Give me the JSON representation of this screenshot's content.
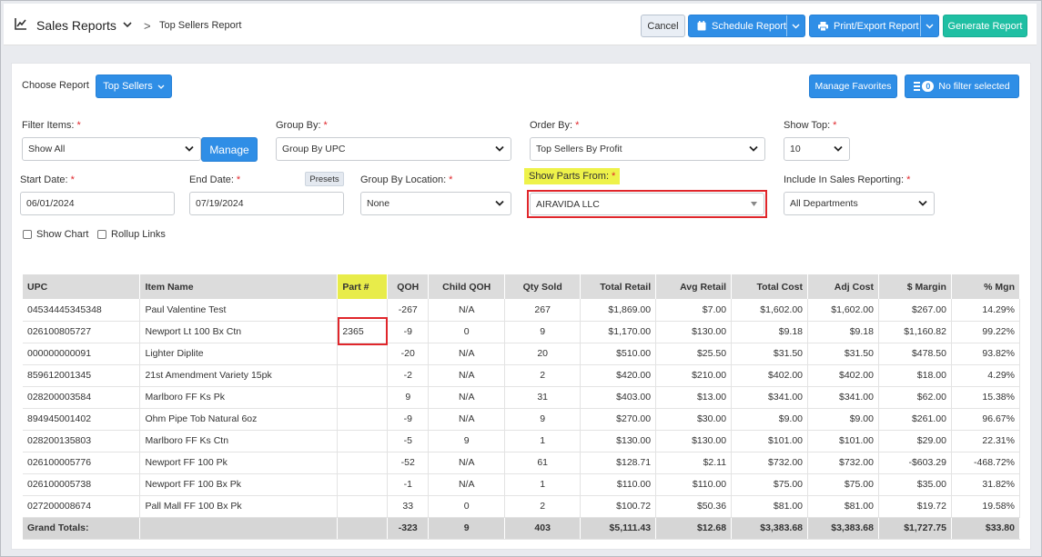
{
  "header": {
    "title": "Sales Reports",
    "crumb_sep": ">",
    "breadcrumb": "Top Sellers Report",
    "cancel": "Cancel",
    "schedule": "Schedule Report",
    "print": "Print/Export Report",
    "generate": "Generate Report"
  },
  "filters": {
    "choose_report_label": "Choose Report",
    "choose_report_value": "Top Sellers",
    "manage_favorites": "Manage Favorites",
    "filter_badge": "0",
    "filter_text": "No filter selected",
    "filter_items_label": "Filter Items:",
    "filter_items_value": "Show All",
    "manage": "Manage",
    "group_by_label": "Group By:",
    "group_by_value": "Group By UPC",
    "order_by_label": "Order By:",
    "order_by_value": "Top Sellers By Profit",
    "show_top_label": "Show Top:",
    "show_top_value": "10",
    "start_date_label": "Start Date:",
    "start_date_value": "06/01/2024",
    "end_date_label": "End Date:",
    "end_date_value": "07/19/2024",
    "presets": "Presets",
    "group_by_location_label": "Group By Location:",
    "group_by_location_value": "None",
    "show_parts_from_label": "Show Parts From:",
    "show_parts_from_value": "AIRAVIDA LLC",
    "include_sales_label": "Include In Sales Reporting:",
    "include_sales_value": "All Departments",
    "show_chart": "Show Chart",
    "rollup_links": "Rollup Links",
    "required_mark": "*"
  },
  "table": {
    "columns": [
      "UPC",
      "Item Name",
      "Part #",
      "QOH",
      "Child QOH",
      "Qty Sold",
      "Total Retail",
      "Avg Retail",
      "Total Cost",
      "Adj Cost",
      "$ Margin",
      "% Mgn"
    ],
    "rows": [
      [
        "04534445345348",
        "Paul Valentine Test",
        "",
        "-267",
        "N/A",
        "267",
        "$1,869.00",
        "$7.00",
        "$1,602.00",
        "$1,602.00",
        "$267.00",
        "14.29%"
      ],
      [
        "026100805727",
        "Newport Lt 100 Bx Ctn",
        "2365",
        "-9",
        "0",
        "9",
        "$1,170.00",
        "$130.00",
        "$9.18",
        "$9.18",
        "$1,160.82",
        "99.22%"
      ],
      [
        "000000000091",
        "Lighter Diplite",
        "",
        "-20",
        "N/A",
        "20",
        "$510.00",
        "$25.50",
        "$31.50",
        "$31.50",
        "$478.50",
        "93.82%"
      ],
      [
        "859612001345",
        "21st Amendment Variety 15pk",
        "",
        "-2",
        "N/A",
        "2",
        "$420.00",
        "$210.00",
        "$402.00",
        "$402.00",
        "$18.00",
        "4.29%"
      ],
      [
        "028200003584",
        "Marlboro FF Ks Pk",
        "",
        "9",
        "N/A",
        "31",
        "$403.00",
        "$13.00",
        "$341.00",
        "$341.00",
        "$62.00",
        "15.38%"
      ],
      [
        "894945001402",
        "Ohm Pipe Tob Natural 6oz",
        "",
        "-9",
        "N/A",
        "9",
        "$270.00",
        "$30.00",
        "$9.00",
        "$9.00",
        "$261.00",
        "96.67%"
      ],
      [
        "028200135803",
        "Marlboro FF Ks Ctn",
        "",
        "-5",
        "9",
        "1",
        "$130.00",
        "$130.00",
        "$101.00",
        "$101.00",
        "$29.00",
        "22.31%"
      ],
      [
        "026100005776",
        "Newport FF 100 Pk",
        "",
        "-52",
        "N/A",
        "61",
        "$128.71",
        "$2.11",
        "$732.00",
        "$732.00",
        "-$603.29",
        "-468.72%"
      ],
      [
        "026100005738",
        "Newport FF 100 Bx Pk",
        "",
        "-1",
        "N/A",
        "1",
        "$110.00",
        "$110.00",
        "$75.00",
        "$75.00",
        "$35.00",
        "31.82%"
      ],
      [
        "027200008674",
        "Pall Mall FF 100 Bx Pk",
        "",
        "33",
        "0",
        "2",
        "$100.72",
        "$50.36",
        "$81.00",
        "$81.00",
        "$19.72",
        "19.58%"
      ]
    ],
    "totals": [
      "Grand Totals:",
      "",
      "",
      "-323",
      "9",
      "403",
      "$5,111.43",
      "$12.68",
      "$3,383.68",
      "$3,383.68",
      "$1,727.75",
      "$33.80"
    ]
  }
}
